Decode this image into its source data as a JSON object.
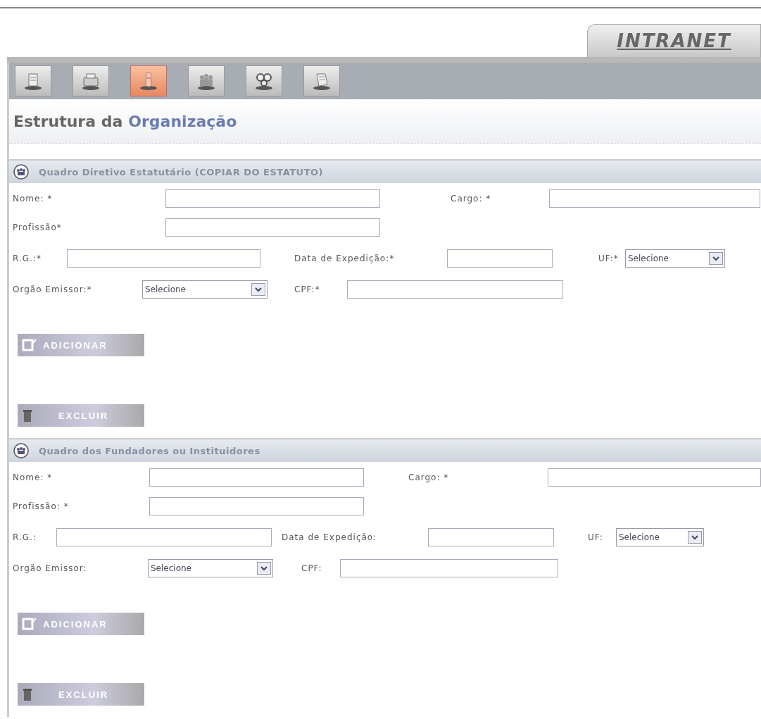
{
  "tab": {
    "label": "INTRANET"
  },
  "toolbar": [
    {
      "kind": "document",
      "selected": false
    },
    {
      "kind": "machine",
      "selected": false
    },
    {
      "kind": "person",
      "selected": true
    },
    {
      "kind": "group",
      "selected": false
    },
    {
      "kind": "gears",
      "selected": false
    },
    {
      "kind": "scroll",
      "selected": false
    }
  ],
  "page_title": {
    "text": "Estrutura da",
    "highlight": "Organização"
  },
  "sections": [
    {
      "title": "Quadro Diretivo Estatutário (COPIAR DO ESTATUTO)",
      "rows": [
        [
          {
            "label": "Nome: *",
            "kind": "text"
          },
          {
            "label": "Cargo: *",
            "kind": "text"
          }
        ],
        [
          {
            "label": "Profissão*",
            "kind": "text"
          }
        ],
        [
          {
            "label": "R.G.:*",
            "kind": "text"
          },
          {
            "label": "Data de Expedição:*",
            "kind": "text"
          },
          {
            "label": "UF:*",
            "kind": "select",
            "value": "Selecione"
          }
        ],
        [
          {
            "label": "Orgão Emissor:*",
            "kind": "select",
            "value": "Selecione"
          },
          {
            "label": "CPF:*",
            "kind": "text"
          }
        ]
      ],
      "buttons": [
        {
          "kind": "add",
          "label": "ADICIONAR"
        },
        {
          "kind": "delete",
          "label": "EXCLUIR"
        }
      ]
    },
    {
      "title": "Quadro dos Fundadores ou Instituidores",
      "rows": [
        [
          {
            "label": "Nome: *",
            "kind": "text"
          },
          {
            "label": "Cargo: *",
            "kind": "text"
          }
        ],
        [
          {
            "label": "Profissão: *",
            "kind": "text"
          }
        ],
        [
          {
            "label": "R.G.:",
            "kind": "text"
          },
          {
            "label": "Data de Expedição:",
            "kind": "text"
          },
          {
            "label": "UF:",
            "kind": "select",
            "value": "Selecione"
          }
        ],
        [
          {
            "label": "Orgão Emissor:",
            "kind": "select",
            "value": "Selecione"
          },
          {
            "label": "CPF:",
            "kind": "text"
          }
        ]
      ],
      "buttons": [
        {
          "kind": "add",
          "label": "ADICIONAR"
        },
        {
          "kind": "delete",
          "label": "EXCLUIR"
        }
      ]
    }
  ]
}
